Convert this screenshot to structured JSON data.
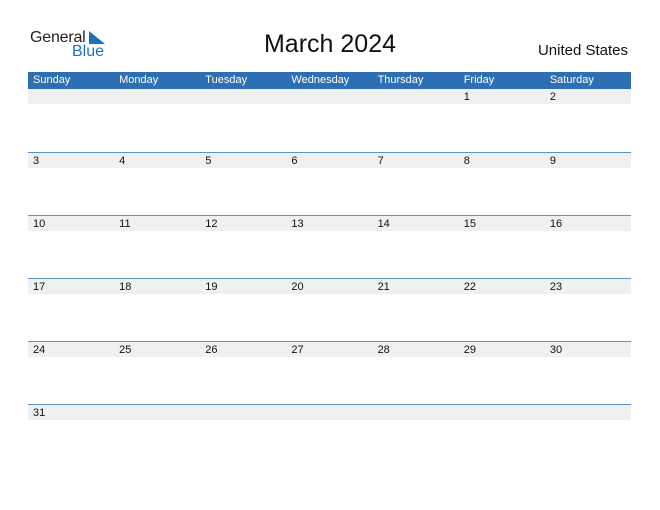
{
  "logo": {
    "word1": "General",
    "word2": "Blue",
    "color": "#1f72b8"
  },
  "title": "March 2024",
  "country": "United States",
  "header_color": "#2e6fb3",
  "weekdays": [
    "Sunday",
    "Monday",
    "Tuesday",
    "Wednesday",
    "Thursday",
    "Friday",
    "Saturday"
  ],
  "weeks": [
    [
      "",
      "",
      "",
      "",
      "",
      "1",
      "2"
    ],
    [
      "3",
      "4",
      "5",
      "6",
      "7",
      "8",
      "9"
    ],
    [
      "10",
      "11",
      "12",
      "13",
      "14",
      "15",
      "16"
    ],
    [
      "17",
      "18",
      "19",
      "20",
      "21",
      "22",
      "23"
    ],
    [
      "24",
      "25",
      "26",
      "27",
      "28",
      "29",
      "30"
    ],
    [
      "31",
      "",
      "",
      "",
      "",
      "",
      ""
    ]
  ]
}
